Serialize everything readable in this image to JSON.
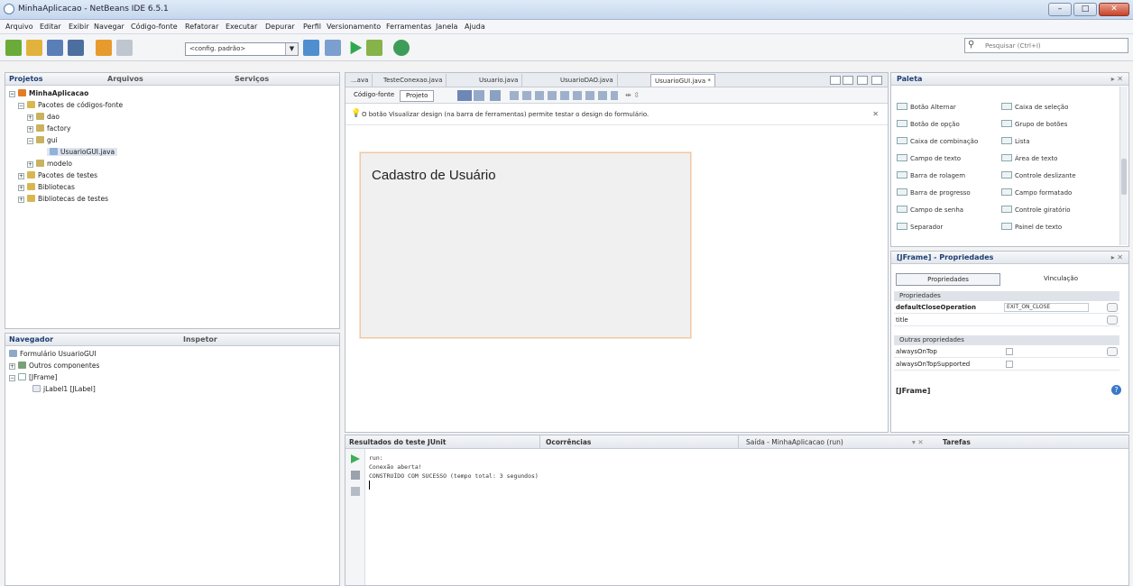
{
  "window": {
    "title": "MinhaAplicacao - NetBeans IDE 6.5.1"
  },
  "menu": [
    "Arquivo",
    "Editar",
    "Exibir",
    "Navegar",
    "Código-fonte",
    "Refatorar",
    "Executar",
    "Depurar",
    "Perfil",
    "Versionamento",
    "Ferramentas",
    "Janela",
    "Ajuda"
  ],
  "toolbar": {
    "config_value": "<config. padrão>",
    "search_placeholder": "Pesquisar (Ctrl+I)"
  },
  "projects_panel": {
    "tabs": [
      "Projetos",
      "Arquivos",
      "Serviços"
    ],
    "tree": [
      "MinhaAplicacao",
      "Pacotes de códigos-fonte",
      "dao",
      "factory",
      "gui",
      "UsuarioGUI.java",
      "modelo",
      "Pacotes de testes",
      "Bibliotecas",
      "Bibliotecas de testes"
    ]
  },
  "navigator_panel": {
    "tabs": [
      "Navegador",
      "Inspetor"
    ],
    "tree": [
      "Formulário UsuarioGUI",
      "Outros componentes",
      "[JFrame]",
      "jLabel1 [JLabel]"
    ]
  },
  "editor": {
    "tabs": [
      "...ava",
      "TesteConexao.java",
      "Usuario.java",
      "UsuarioDAO.java",
      "UsuarioGUI.java *"
    ],
    "view_buttons": [
      "Código-fonte",
      "Projeto"
    ],
    "info_message": "O botão Visualizar design (na barra de ferramentas) permite testar o design do formulário.",
    "form_label": "Cadastro de Usuário"
  },
  "palette": {
    "title": "Paleta",
    "items": [
      "Botão Alternar",
      "Caixa de seleção",
      "Botão de opção",
      "Grupo de botões",
      "Caixa de combinação",
      "Lista",
      "Campo de texto",
      "Área de texto",
      "Barra de rolagem",
      "Controle deslizante",
      "Barra de progresso",
      "Campo formatado",
      "Campo de senha",
      "Controle giratório",
      "Separador",
      "Painel de texto"
    ]
  },
  "properties": {
    "title": "[JFrame] - Propriedades",
    "tabs": [
      "Propriedades",
      "Vinculação"
    ],
    "section1": "Propriedades",
    "rows1": [
      {
        "name": "defaultCloseOperation",
        "value": "EXIT_ON_CLOSE"
      },
      {
        "name": "title",
        "value": ""
      }
    ],
    "section2": "Outras propriedades",
    "rows2": [
      "alwaysOnTop",
      "alwaysOnTopSupported"
    ],
    "footer": "[JFrame]"
  },
  "output": {
    "tabs": [
      "Resultados do teste JUnit",
      "Ocorrências",
      "Saída - MinhaAplicacao (run)",
      "Tarefas"
    ],
    "lines": [
      "run:",
      "Conexão aberta!",
      "CONSTRUÍDO COM SUCESSO (tempo total: 3 segundos)"
    ]
  }
}
